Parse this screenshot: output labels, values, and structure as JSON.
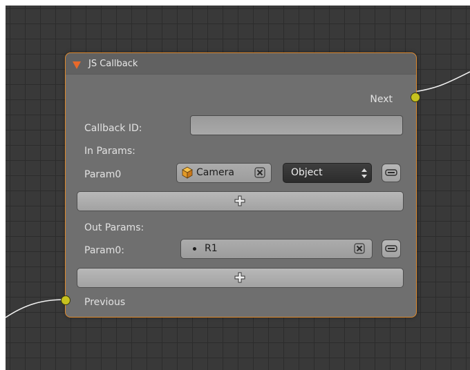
{
  "node": {
    "title": "JS Callback",
    "outputs": {
      "next": "Next"
    },
    "inputs": {
      "previous": "Previous"
    },
    "callback_id": {
      "label": "Callback ID:",
      "value": ""
    },
    "in_params": {
      "label": "In Params:",
      "rows": [
        {
          "name": "Param0",
          "value": "Camera",
          "type": "Object"
        }
      ]
    },
    "out_params": {
      "label": "Out Params:",
      "rows": [
        {
          "name": "Param0:",
          "value": "R1"
        }
      ]
    }
  },
  "colors": {
    "node_border": "#e08a2c",
    "socket": "#c7c21e",
    "collapse_arrow": "#e8692a",
    "object_icon": "#e8a234"
  },
  "icons": [
    "collapse-triangle-icon",
    "object-cube-icon",
    "clear-x-icon",
    "updown-arrows-icon",
    "minus-icon",
    "plus-icon",
    "bullet-icon"
  ]
}
